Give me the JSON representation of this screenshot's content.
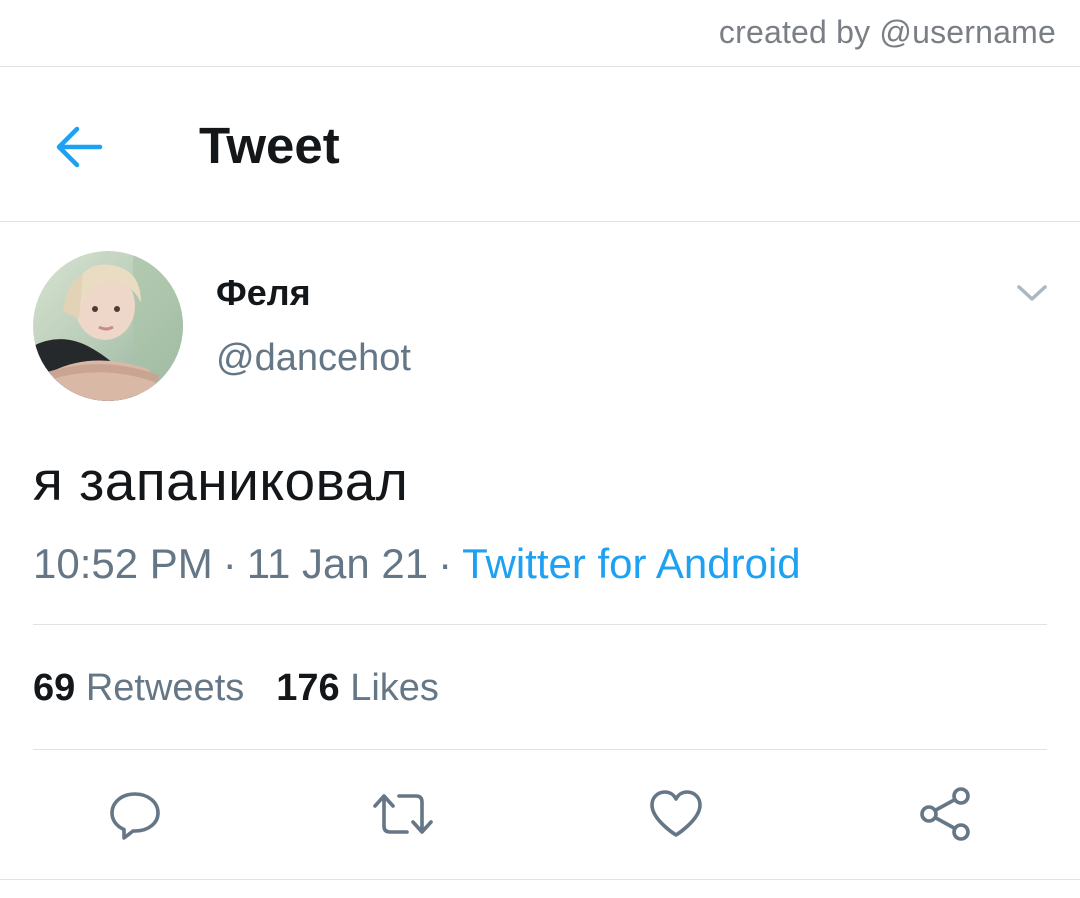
{
  "watermark": {
    "text": "created by @username"
  },
  "header": {
    "title": "Tweet",
    "back_icon": "arrow-left-icon"
  },
  "author": {
    "display_name": "Феля",
    "handle": "@dancehot",
    "avatar": "profile-photo"
  },
  "tweet": {
    "text": "я запаниковал",
    "time": "10:52 PM",
    "separator": "·",
    "date": "11 Jan 21",
    "source": "Twitter for Android"
  },
  "stats": {
    "retweets_count": "69",
    "retweets_label": "Retweets",
    "likes_count": "176",
    "likes_label": "Likes"
  },
  "actions": [
    {
      "icon": "reply-icon"
    },
    {
      "icon": "retweet-icon"
    },
    {
      "icon": "like-icon"
    },
    {
      "icon": "share-icon"
    }
  ],
  "colors": {
    "accent": "#1da1f2",
    "text_primary": "#14171a",
    "text_secondary": "#657786",
    "divider": "#dfe3e6",
    "icon": "#657786"
  }
}
